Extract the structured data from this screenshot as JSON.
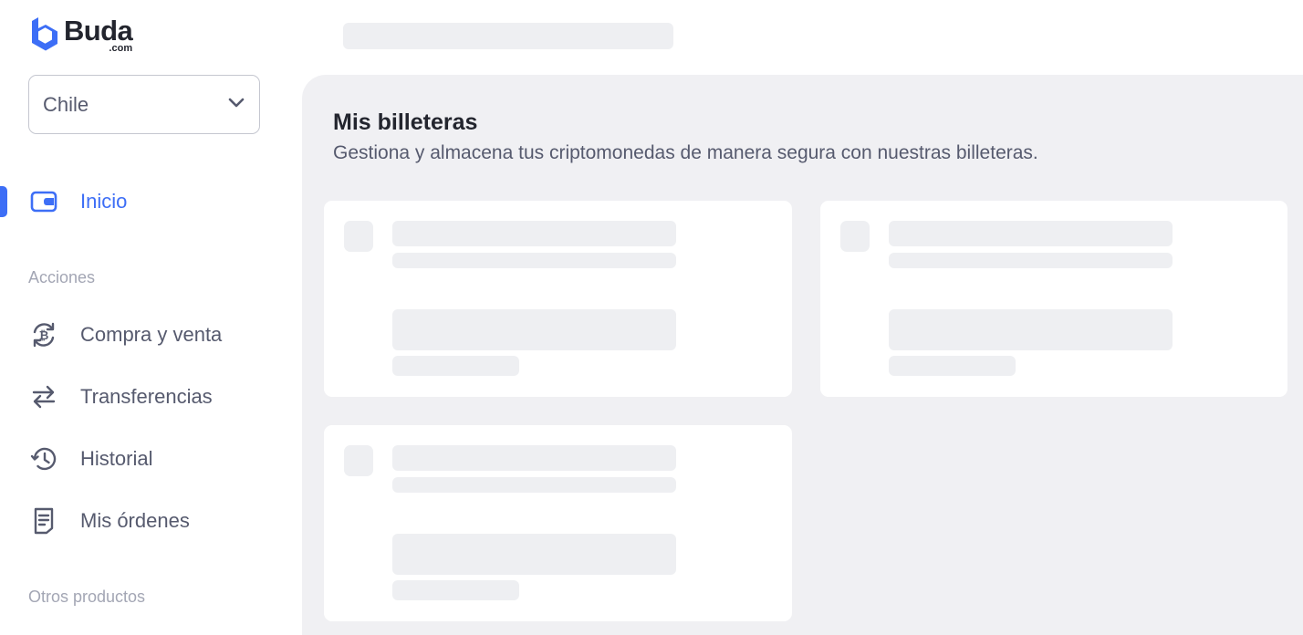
{
  "brand": {
    "name": "Buda",
    "domain": ".com",
    "color": "#3d6ef6"
  },
  "country_select": {
    "value": "Chile",
    "icon": "chevron-down-icon"
  },
  "nav": {
    "inicio": {
      "label": "Inicio",
      "icon": "wallet-icon",
      "active": true
    },
    "acciones_label": "Acciones",
    "compra_venta": {
      "label": "Compra y venta",
      "icon": "bitcoin-exchange-icon"
    },
    "transferencias": {
      "label": "Transferencias",
      "icon": "transfer-arrows-icon"
    },
    "historial": {
      "label": "Historial",
      "icon": "history-icon"
    },
    "ordenes": {
      "label": "Mis órdenes",
      "icon": "document-icon"
    },
    "otros_label": "Otros productos"
  },
  "main": {
    "title": "Mis billeteras",
    "subtitle": "Gestiona y almacena tus criptomonedas de manera segura con nuestras billeteras.",
    "wallet_cards_loading": 3
  },
  "colors": {
    "accent": "#3d6ef6",
    "panel_bg": "#f0f0f3",
    "skeleton": "#eeeff2",
    "text": "#565a6e",
    "muted": "#a3a6b4",
    "heading": "#23252e"
  }
}
